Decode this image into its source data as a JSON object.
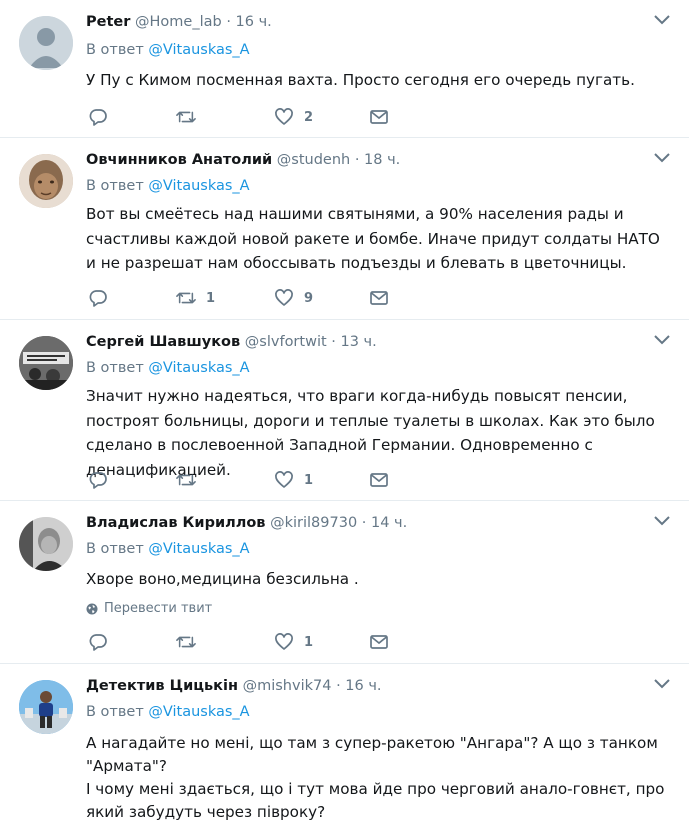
{
  "ui": {
    "reply_prefix": "В ответ",
    "translate_label": "Перевести твит"
  },
  "tweets": [
    {
      "name": "Peter",
      "handle": "@Home_lab",
      "dot": "·",
      "time": "16 ч.",
      "reply_to": "@Vitauskas_A",
      "text": "У Пу  с Кимом посменная вахта. Просто сегодня его очередь пугать.",
      "retweets": "",
      "likes": "2"
    },
    {
      "name": "Овчинников Анатолий",
      "handle": "@studenh",
      "dot": "·",
      "time": "18 ч.",
      "reply_to": "@Vitauskas_A",
      "text": "Вот вы смеётесь над нашими святынями, а 90% населения рады и счастливы каждой новой ракете и бомбе. Иначе придут солдаты НАТО и не разрешат нам обоссывать подъезды и блевать в цветочницы.",
      "retweets": "1",
      "likes": "9"
    },
    {
      "name": "Сергей Шавшуков",
      "handle": "@slvfortwit",
      "dot": "·",
      "time": "13 ч.",
      "reply_to": "@Vitauskas_A",
      "text": "Значит нужно надеяться, что враги когда-нибудь повысят пенсии, построят больницы, дороги и теплые туалеты в школах. Как это было сделано в послевоенной Западной Германии. Одновременно с денацификацией.",
      "retweets": "",
      "likes": "1"
    },
    {
      "name": "Владислав Кириллов",
      "handle": "@kiril89730",
      "dot": "·",
      "time": "14 ч.",
      "reply_to": "@Vitauskas_A",
      "text": "Хворе воно,медицина безсильна .",
      "retweets": "",
      "likes": "1"
    },
    {
      "name": "Детектив Цицькін",
      "handle": "@mishvik74",
      "dot": "·",
      "time": "16 ч.",
      "reply_to": "@Vitauskas_A",
      "text": "А нагадайте но мені, що там з супер-ракетою \"Ангара\"? А що з танком \"Армата\"?\nІ чому мені здається, що і тут мова йде про черговий анало-говнєт, про який забудуть через півроку?",
      "retweets": "",
      "likes": ""
    }
  ],
  "colors": {
    "link": "#1b95e0",
    "secondary": "#657786",
    "border": "#e6ecf0"
  },
  "icons": [
    "chevron-down-icon",
    "reply-icon",
    "retweet-icon",
    "like-icon",
    "direct-message-icon",
    "globe-icon"
  ]
}
